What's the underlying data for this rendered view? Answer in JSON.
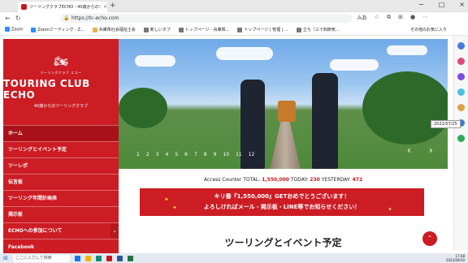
{
  "browser": {
    "tab_title": "ツーリングクラブECHO - 40歳からのツ",
    "tab_close": "×",
    "new_tab": "+",
    "url": "https://tc-echo.com",
    "window_controls": [
      "−",
      "□",
      "×"
    ]
  },
  "bookmarks": [
    {
      "label": "Zoom",
      "icon": "zoom-icon",
      "color": "#2d8cff"
    },
    {
      "label": "Zoomミーティング - Z...",
      "icon": "zoom-icon",
      "color": "#2d8cff"
    },
    {
      "label": "兵庫県社会福祉士会",
      "icon": "folder-icon",
      "color": "#e8b04a"
    },
    {
      "label": "新しいタブ",
      "icon": "page-icon",
      "color": "#777777"
    },
    {
      "label": "トップページ - 兵庫県...",
      "icon": "page-icon",
      "color": "#777777"
    },
    {
      "label": "トップページ | 管理 | ...",
      "icon": "page-icon",
      "color": "#777777"
    },
    {
      "label": "立ち（三十四節気...",
      "icon": "page-icon",
      "color": "#777777"
    }
  ],
  "bookmarks_right": "その他のお気に入り",
  "site": {
    "logo_sub": "ツーリングクラブ エコー",
    "logo_main": "TOURING CLUB ECHO",
    "logo_tagline": "40歳からのツーリングクラブ",
    "menu": [
      {
        "label": "ホーム",
        "active": true,
        "has_sub": false
      },
      {
        "label": "ツーリングとイベント予定",
        "active": false,
        "has_sub": false
      },
      {
        "label": "ツーレポ",
        "active": false,
        "has_sub": false
      },
      {
        "label": "伝言板",
        "active": false,
        "has_sub": false
      },
      {
        "label": "ツーリング年間計画表",
        "active": false,
        "has_sub": false
      },
      {
        "label": "掲示板",
        "active": false,
        "has_sub": false
      },
      {
        "label": "ECHOへの参加について",
        "active": false,
        "has_sub": true
      },
      {
        "label": "Facebook",
        "active": false,
        "has_sub": false
      }
    ],
    "slider_dots": [
      "1",
      "2",
      "3",
      "4",
      "5",
      "6",
      "7",
      "8",
      "9",
      "10",
      "11",
      "12"
    ],
    "slider_date": "2022/07/25",
    "counter": {
      "label": "Access Counter",
      "total_label": "TOTAL:",
      "total": "1,550,000",
      "today_label": "TODAY:",
      "today": "230",
      "yesterday_label": "YESTERDAY:",
      "yesterday": "472"
    },
    "banner_line1": "キリ番『1,550,000』GETおめでとうございます！",
    "banner_line2": "よろしければメール・掲示板・LINE等でお知らせください！",
    "section_heading": "ツーリングとイベント予定"
  },
  "taskbar": {
    "search_placeholder": "ここに入力して検索",
    "time": "17:08",
    "date": "2022/09/30"
  }
}
